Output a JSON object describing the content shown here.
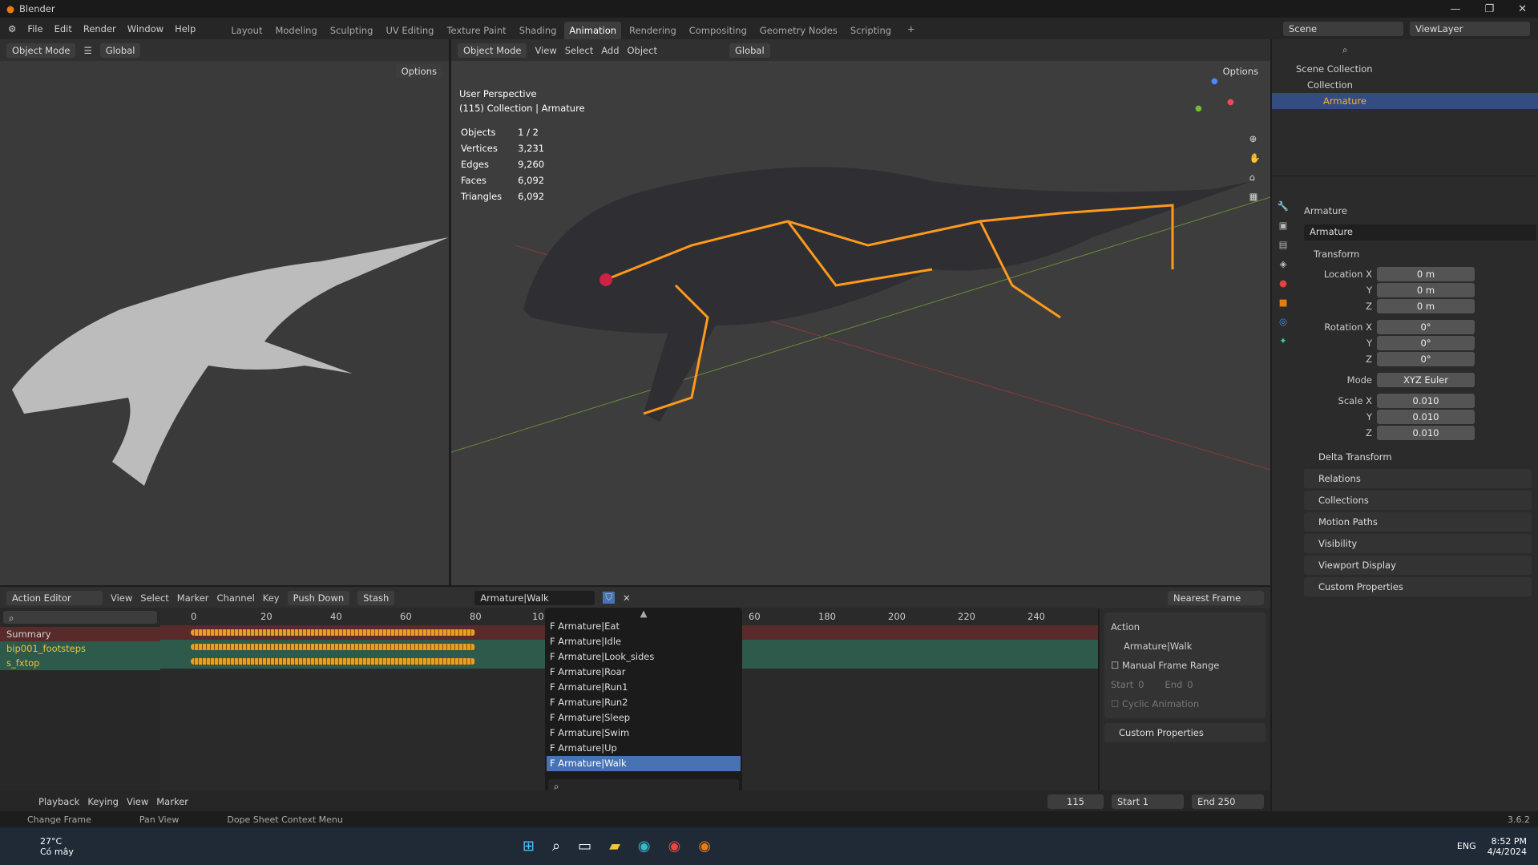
{
  "app": {
    "title": "Blender"
  },
  "menu": [
    "File",
    "Edit",
    "Render",
    "Window",
    "Help"
  ],
  "workspaces": [
    "Layout",
    "Modeling",
    "Sculpting",
    "UV Editing",
    "Texture Paint",
    "Shading",
    "Animation",
    "Rendering",
    "Compositing",
    "Geometry Nodes",
    "Scripting"
  ],
  "active_workspace": "Animation",
  "scene": "Scene",
  "view_layer": "ViewLayer",
  "left_view": {
    "mode": "Object Mode",
    "orientation": "Global",
    "options": "Options"
  },
  "main_view": {
    "mode": "Object Mode",
    "menus": [
      "View",
      "Select",
      "Add",
      "Object"
    ],
    "orientation": "Global",
    "options": "Options",
    "perspective": "User Perspective",
    "context": "(115) Collection | Armature",
    "stats": [
      {
        "k": "Objects",
        "v": "1 / 2"
      },
      {
        "k": "Vertices",
        "v": "3,231"
      },
      {
        "k": "Edges",
        "v": "9,260"
      },
      {
        "k": "Faces",
        "v": "6,092"
      },
      {
        "k": "Triangles",
        "v": "6,092"
      }
    ]
  },
  "outliner": {
    "items": [
      "Scene Collection",
      "Collection",
      "Armature"
    ]
  },
  "properties": {
    "object": "Armature",
    "name_field": "Armature",
    "transform": "Transform",
    "location": {
      "label": "Location X",
      "x": "0 m",
      "y": "0 m",
      "z": "0 m"
    },
    "rotation": {
      "label": "Rotation X",
      "x": "0°",
      "y": "0°",
      "z": "0°"
    },
    "mode_label": "Mode",
    "mode": "XYZ Euler",
    "scale": {
      "label": "Scale X",
      "x": "0.010",
      "y": "0.010",
      "z": "0.010"
    },
    "axis": {
      "y": "Y",
      "z": "Z"
    },
    "sections": [
      "Delta Transform",
      "Relations",
      "Collections",
      "Motion Paths",
      "Visibility",
      "Viewport Display",
      "Custom Properties"
    ]
  },
  "dopesheet": {
    "editor": "Action Editor",
    "menus": [
      "View",
      "Select",
      "Marker",
      "Channel",
      "Key"
    ],
    "push_down": "Push Down",
    "stash": "Stash",
    "action": "Armature|Walk",
    "snap": "Nearest Frame",
    "ticks": [
      "0",
      "20",
      "40",
      "60",
      "80",
      "10",
      "60",
      "180",
      "200",
      "220",
      "240"
    ],
    "channels": [
      "Summary",
      "bip001_footsteps",
      "s_fxtop"
    ],
    "dropdown": [
      "F Armature|Eat",
      "F Armature|Idle",
      "F Armature|Look_sides",
      "F Armature|Roar",
      "F Armature|Run1",
      "F Armature|Run2",
      "F Armature|Sleep",
      "F Armature|Swim",
      "F Armature|Up",
      "F Armature|Walk"
    ],
    "side": {
      "title": "Action",
      "action": "Armature|Walk",
      "manual": "Manual Frame Range",
      "start_l": "Start",
      "start": "0",
      "end_l": "End",
      "end": "0",
      "cyclic": "Cyclic Animation",
      "custom": "Custom Properties"
    }
  },
  "timeline": {
    "menus": [
      "Playback",
      "Keying",
      "View",
      "Marker"
    ],
    "frame": "115",
    "start_l": "Start",
    "start": "1",
    "end_l": "End",
    "end": "250"
  },
  "status": {
    "items": [
      "Change Frame",
      "Pan View",
      "Dope Sheet Context Menu"
    ],
    "version": "3.6.2"
  },
  "taskbar": {
    "temp": "27°C",
    "weather": "Có mây",
    "lang": "ENG",
    "time": "8:52 PM",
    "date": "4/4/2024"
  },
  "colors": {
    "accent": "#4772b3",
    "summary": "#5a2a2a",
    "channel": "#2d5a4a",
    "keyframe": "#e8a020",
    "bone": "#ff9a1a"
  }
}
